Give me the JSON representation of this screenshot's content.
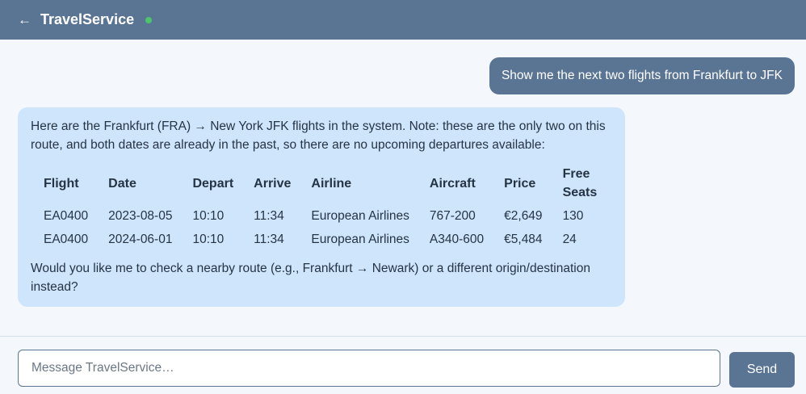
{
  "header": {
    "back_icon": "←",
    "title": "TravelService",
    "status": "online",
    "status_color": "#4cc46a"
  },
  "messages": {
    "user": {
      "text": "Show me the next two flights from Frankfurt to JFK"
    },
    "assistant": {
      "intro": "Here are the Frankfurt (FRA) → New York JFK flights in the system. Note: these are the only two on this route, and both dates are already in the past, so there are no upcoming departures available:",
      "table": {
        "headers": [
          "Flight",
          "Date",
          "Depart",
          "Arrive",
          "Airline",
          "Aircraft",
          "Price",
          "Free Seats"
        ],
        "rows": [
          [
            "EA0400",
            "2023-08-05",
            "10:10",
            "11:34",
            "European Airlines",
            "767-200",
            "€2,649",
            "130"
          ],
          [
            "EA0400",
            "2024-06-01",
            "10:10",
            "11:34",
            "European Airlines",
            "A340-600",
            "€5,484",
            "24"
          ]
        ]
      },
      "outro": "Would you like me to check a nearby route (e.g., Frankfurt → Newark) or a different origin/destination instead?"
    }
  },
  "composer": {
    "placeholder": "Message TravelService…",
    "value": "",
    "send_label": "Send"
  },
  "colors": {
    "header_bg": "#5a7494",
    "user_bubble": "#5a7494",
    "assistant_bubble": "#cfe5fb",
    "background": "#f4f8fc"
  }
}
